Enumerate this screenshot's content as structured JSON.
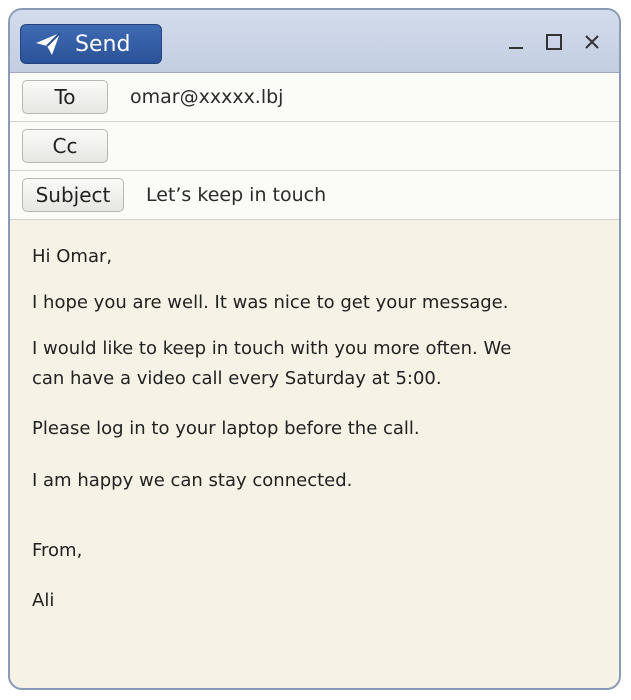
{
  "toolbar": {
    "send_label": "Send",
    "send_icon": "paper-plane-icon",
    "window_controls": [
      "minimize-icon",
      "maximize-icon",
      "close-icon"
    ]
  },
  "fields": {
    "to_label": "To",
    "to_value": "omar@xxxxx.lbj",
    "cc_label": "Cc",
    "cc_value": "",
    "subject_label": "Subject",
    "subject_value": "Let’s keep in touch"
  },
  "message": {
    "greeting": "Hi Omar,",
    "paragraph_1": "I hope you are well. It was nice to get your message.",
    "paragraph_2_line_1": "I would like to keep in touch with you more often. We",
    "paragraph_2_line_2": "can have a video call every Saturday at 5:00.",
    "paragraph_3": "Please log in to your laptop before the call.",
    "paragraph_4": "I am happy we can stay connected.",
    "closing": "From,",
    "signature": "Ali"
  },
  "colors": {
    "send_button": "#2f5aa3",
    "titlebar": "#c9d3e6",
    "body_background": "#f6f2e6"
  }
}
